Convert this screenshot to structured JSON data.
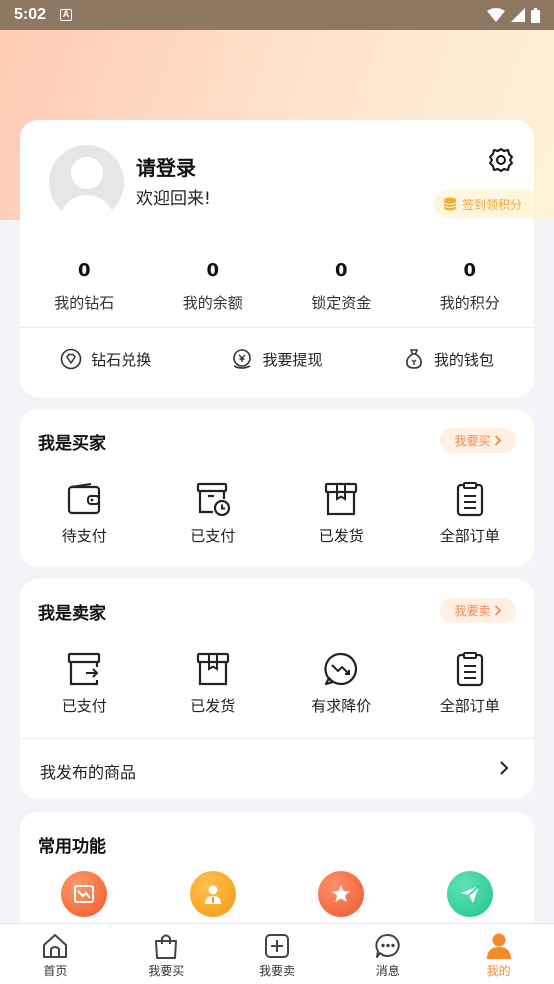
{
  "status_bar": {
    "time": "5:02",
    "badge": "A"
  },
  "profile": {
    "title": "请登录",
    "welcome": "欢迎回来!",
    "checkin_label": "签到领积分",
    "stats": [
      {
        "value": "0",
        "label": "我的钻石"
      },
      {
        "value": "0",
        "label": "我的余额"
      },
      {
        "value": "0",
        "label": "锁定资金"
      },
      {
        "value": "0",
        "label": "我的积分"
      }
    ],
    "quick": [
      {
        "label": "钻石兑换",
        "icon": "diamond-icon"
      },
      {
        "label": "我要提现",
        "icon": "withdraw-icon"
      },
      {
        "label": "我的钱包",
        "icon": "wallet-icon"
      }
    ]
  },
  "buyer": {
    "title": "我是买家",
    "pill": "我要买",
    "items": [
      {
        "label": "待支付",
        "icon": "wallet-icon"
      },
      {
        "label": "已支付",
        "icon": "box-clock-icon"
      },
      {
        "label": "已发货",
        "icon": "box-icon"
      },
      {
        "label": "全部订单",
        "icon": "clipboard-icon"
      }
    ]
  },
  "seller": {
    "title": "我是卖家",
    "pill": "我要卖",
    "items": [
      {
        "label": "已支付",
        "icon": "box-export-icon"
      },
      {
        "label": "已发货",
        "icon": "box-icon"
      },
      {
        "label": "有求降价",
        "icon": "trend-down-chat-icon"
      },
      {
        "label": "全部订单",
        "icon": "clipboard-icon"
      }
    ],
    "published": "我发布的商品"
  },
  "common": {
    "title": "常用功能",
    "icons": [
      {
        "icon": "chart-down-icon",
        "color": "#f26a3a"
      },
      {
        "icon": "service-person-icon",
        "color": "#f7a421"
      },
      {
        "icon": "star-icon",
        "color": "#f06b3e"
      },
      {
        "icon": "send-icon",
        "color": "#2fcf9a"
      }
    ]
  },
  "tabbar": [
    {
      "label": "首页",
      "icon": "home-icon",
      "active": false
    },
    {
      "label": "我要买",
      "icon": "shopping-bag-icon",
      "active": false
    },
    {
      "label": "我要卖",
      "icon": "plus-square-icon",
      "active": false
    },
    {
      "label": "消息",
      "icon": "chat-icon",
      "active": false
    },
    {
      "label": "我的",
      "icon": "user-icon",
      "active": true
    }
  ],
  "colors": {
    "accent": "#f58a27",
    "pill_text": "#f08a4b",
    "checkin_text": "#f2a43a"
  }
}
